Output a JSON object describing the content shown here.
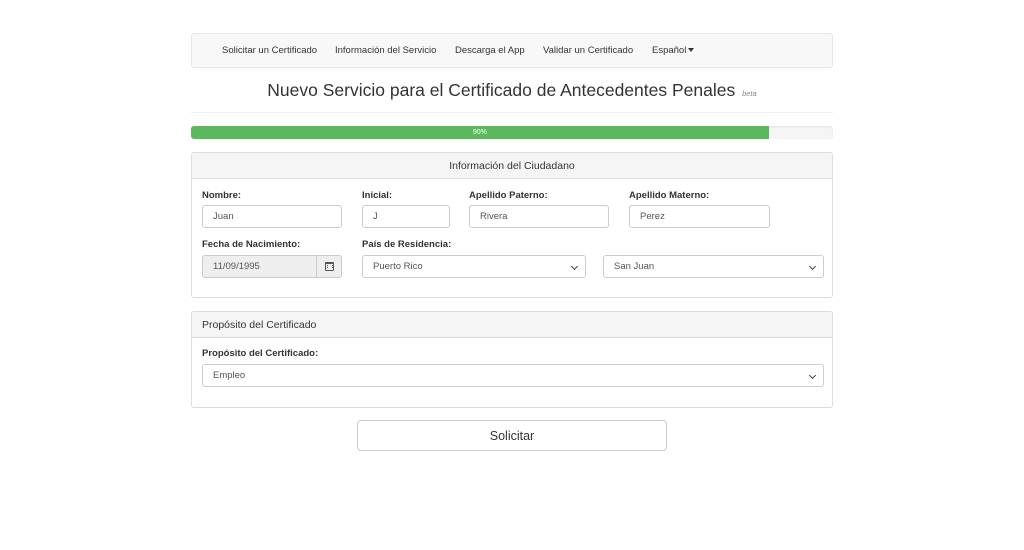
{
  "nav": {
    "items": [
      {
        "label": "Solicitar un Certificado"
      },
      {
        "label": "Información del Servicio"
      },
      {
        "label": "Descarga el App"
      },
      {
        "label": "Validar un Certificado"
      }
    ],
    "language": "Español"
  },
  "header": {
    "title": "Nuevo Servicio para el Certificado de Antecedentes Penales",
    "badge": "beta"
  },
  "progress": {
    "percent": 90,
    "label": "90%",
    "color": "#5cb85c"
  },
  "citizen_panel": {
    "title": "Información del Ciudadano",
    "nombre": {
      "label": "Nombre:",
      "value": "Juan"
    },
    "inicial": {
      "label": "Inicial:",
      "value": "J"
    },
    "apellido_paterno": {
      "label": "Apellido Paterno:",
      "value": "Rivera"
    },
    "apellido_materno": {
      "label": "Apellido Materno:",
      "value": "Perez"
    },
    "fecha_nacimiento": {
      "label": "Fecha de Nacimiento:",
      "value": "11/09/1995",
      "icon": "calendar-icon"
    },
    "pais_residencia": {
      "label": "País de Residencia:",
      "country": "Puerto Rico",
      "city": "San Juan"
    }
  },
  "purpose_panel": {
    "title": "Propósito del Certificado",
    "label": "Propósito del Certificado:",
    "value": "Empleo"
  },
  "submit": {
    "label": "Solicitar"
  }
}
